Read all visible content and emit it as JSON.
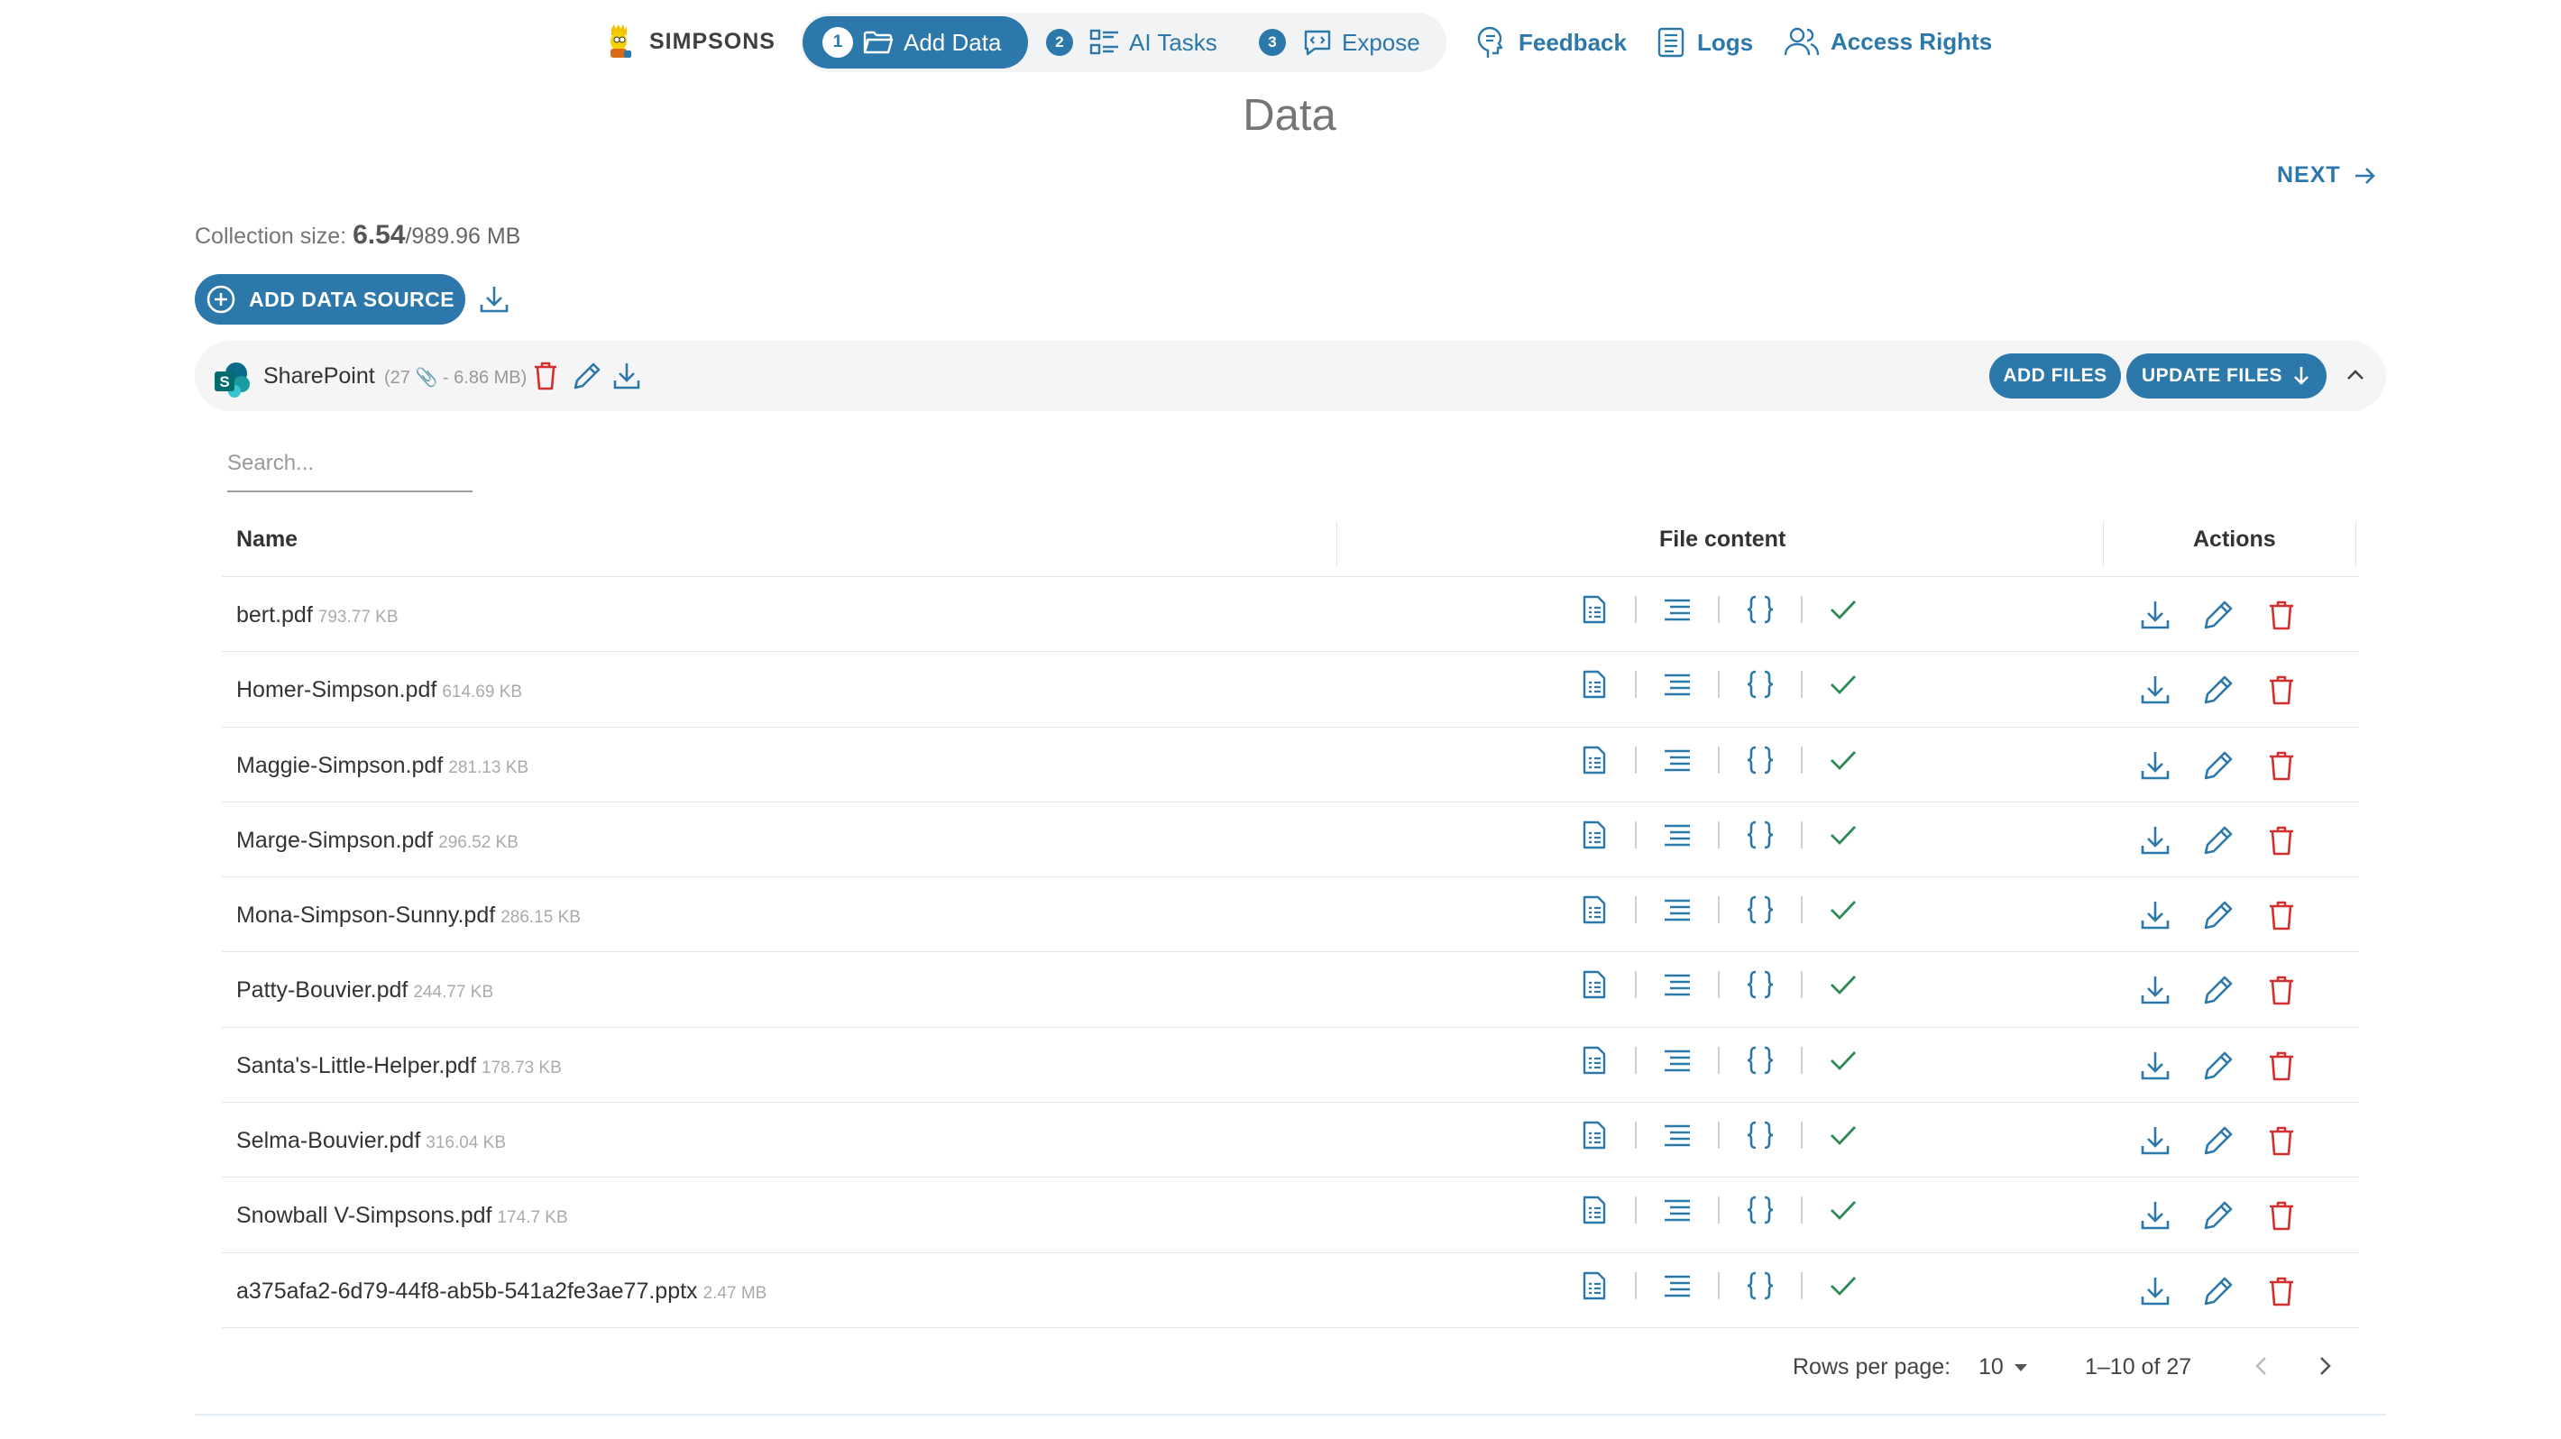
{
  "brand": {
    "name": "SIMPSONS",
    "logo_icon": "simpsons-character-logo"
  },
  "stepper": {
    "steps": [
      {
        "num": "1",
        "label": "Add Data",
        "icon": "folder-icon",
        "active": true
      },
      {
        "num": "2",
        "label": "AI Tasks",
        "icon": "tasks-icon",
        "active": false
      },
      {
        "num": "3",
        "label": "Expose",
        "icon": "expose-icon",
        "active": false
      }
    ]
  },
  "nav": {
    "feedback": "Feedback",
    "logs": "Logs",
    "access_rights": "Access Rights"
  },
  "page": {
    "title": "Data",
    "next_label": "NEXT"
  },
  "collection": {
    "label": "Collection size: ",
    "used": "6.54",
    "total": "/989.96 MB"
  },
  "add_source_label": "ADD DATA SOURCE",
  "source": {
    "name": "SharePoint",
    "meta": "(27 📎 - 6.86 MB)",
    "add_files_label": "ADD FILES",
    "update_files_label": "UPDATE FILES"
  },
  "search": {
    "placeholder": "Search..."
  },
  "table": {
    "headers": {
      "name": "Name",
      "content": "File content",
      "actions": "Actions"
    },
    "rows": [
      {
        "name": "bert.pdf",
        "size": "793.77 KB"
      },
      {
        "name": "Homer-Simpson.pdf",
        "size": "614.69 KB"
      },
      {
        "name": "Maggie-Simpson.pdf",
        "size": "281.13 KB"
      },
      {
        "name": "Marge-Simpson.pdf",
        "size": "296.52 KB"
      },
      {
        "name": "Mona-Simpson-Sunny.pdf",
        "size": "286.15 KB"
      },
      {
        "name": "Patty-Bouvier.pdf",
        "size": "244.77 KB"
      },
      {
        "name": "Santa's-Little-Helper.pdf",
        "size": "178.73 KB"
      },
      {
        "name": "Selma-Bouvier.pdf",
        "size": "316.04 KB"
      },
      {
        "name": "Snowball V-Simpsons.pdf",
        "size": "174.7 KB"
      },
      {
        "name": "a375afa2-6d79-44f8-ab5b-541a2fe3ae77.pptx",
        "size": "2.47 MB"
      }
    ]
  },
  "pagination": {
    "rows_label": "Rows per page:",
    "rows_value": "10",
    "range": "1–10 of 27"
  },
  "colors": {
    "primary": "#2c78ab",
    "danger": "#d32f2f",
    "success": "#2e8b57",
    "surface": "#f5f5f5"
  }
}
